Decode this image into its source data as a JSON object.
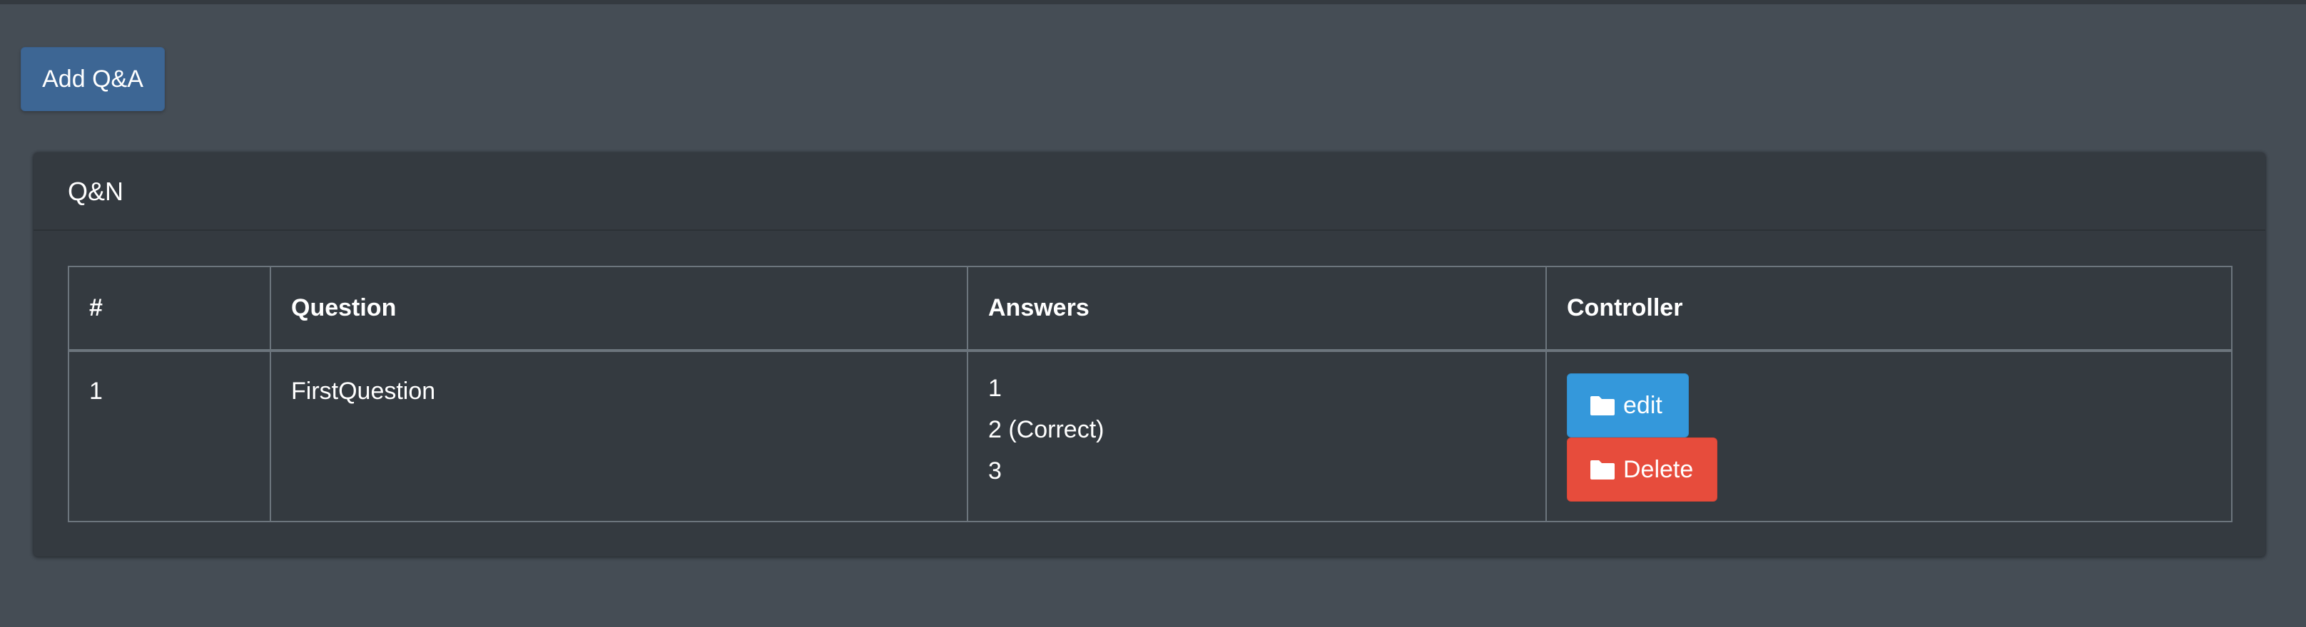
{
  "toolbar": {
    "add_label": "Add Q&A"
  },
  "card": {
    "title": "Q&N"
  },
  "table": {
    "columns": [
      "#",
      "Question",
      "Answers",
      "Controller"
    ],
    "rows": [
      {
        "index": "1",
        "question": "FirstQuestion",
        "answers": [
          "1",
          "2 (Correct)",
          "3"
        ],
        "actions": {
          "edit_label": "edit",
          "delete_label": "Delete"
        }
      }
    ]
  },
  "icons": {
    "edit_icon": "folder-icon",
    "delete_icon": "folder-icon"
  },
  "colors": {
    "background": "#454d55",
    "card": "#343a40",
    "add_button": "#3d6694",
    "edit_button": "#3498db",
    "delete_button": "#e74c3c",
    "border": "#6c757d"
  }
}
